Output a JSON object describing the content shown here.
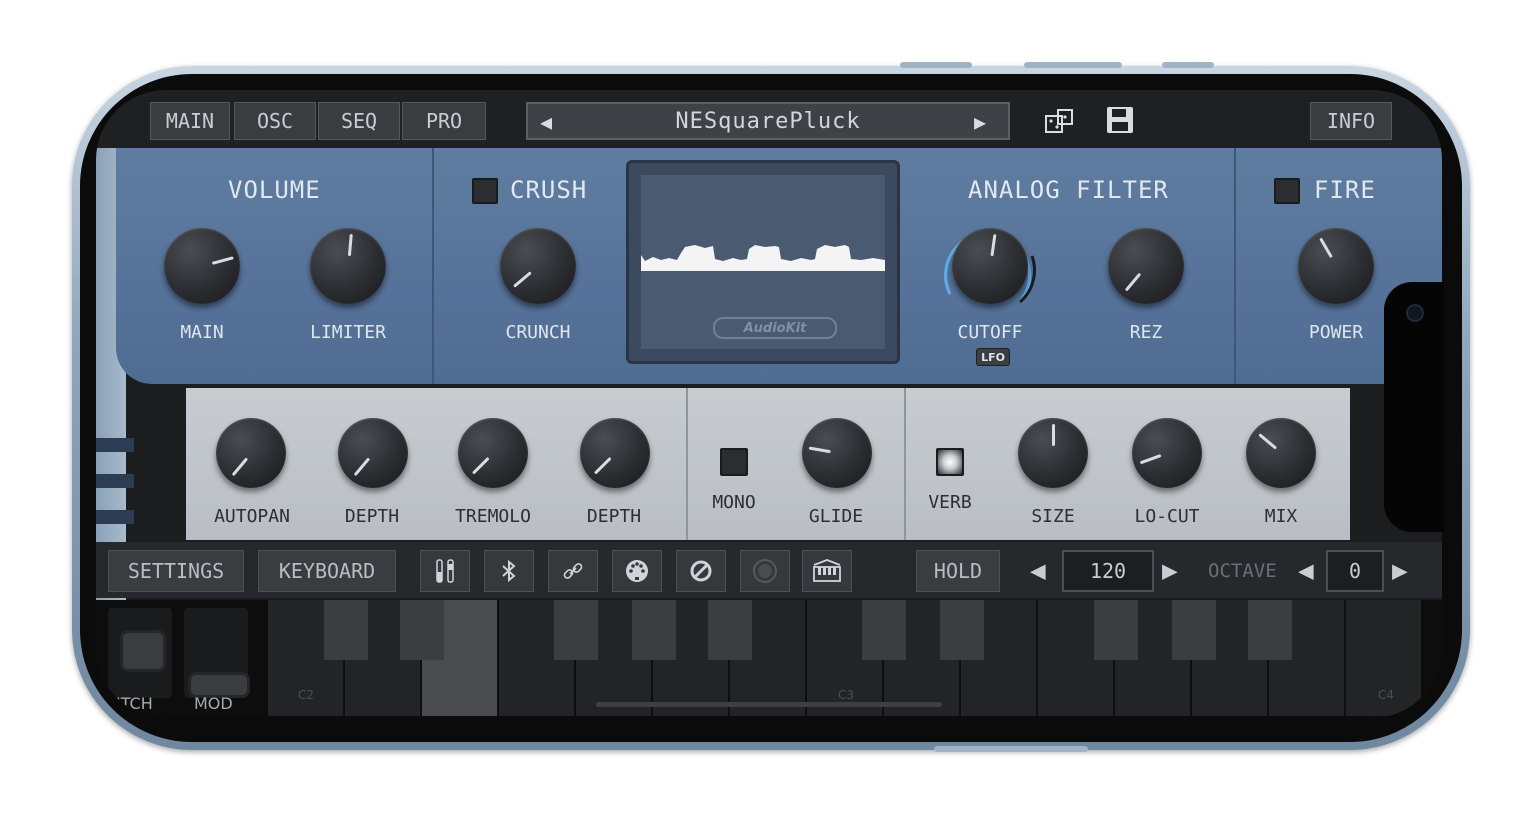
{
  "top": {
    "tabs": [
      "MAIN",
      "OSC",
      "SEQ",
      "PRO"
    ],
    "preset_name": "NESquarePluck",
    "prev_arrow": "◀",
    "next_arrow": "▶",
    "info_label": "INFO",
    "icons": [
      "dice-icon",
      "save-icon"
    ]
  },
  "volume": {
    "title": "VOLUME",
    "knobs": [
      "MAIN",
      "LIMITER"
    ]
  },
  "crush": {
    "title": "CRUSH",
    "knob": "CRUNCH"
  },
  "display": {
    "logo": "AudioKit"
  },
  "filter": {
    "title": "ANALOG FILTER",
    "knobs": [
      "CUTOFF",
      "REZ"
    ],
    "lfo_badge": "LFO"
  },
  "fire": {
    "title": "FIRE",
    "knob": "POWER"
  },
  "fx": {
    "knobs": [
      "AUTOPAN",
      "DEPTH",
      "TREMOLO",
      "DEPTH"
    ],
    "mono_label": "MONO",
    "glide_label": "GLIDE",
    "verb_label": "VERB",
    "verb_knobs": [
      "SIZE",
      "LO-CUT",
      "MIX"
    ]
  },
  "bottom": {
    "settings_label": "SETTINGS",
    "keyboard_label": "KEYBOARD",
    "icon_buttons": [
      "sliders-icon",
      "bluetooth-icon",
      "link-icon",
      "midi-icon",
      "disable-icon",
      "record-icon",
      "piano-icon"
    ],
    "hold_label": "HOLD",
    "tempo_value": "120",
    "octave_label": "OCTAVE",
    "octave_value": "0"
  },
  "keyboard": {
    "pitch_label": "ITCH",
    "mod_label": "MOD",
    "note_labels": [
      "C2",
      "C3",
      "C4"
    ]
  },
  "colors": {
    "panel_blue": "#56729a",
    "panel_grey": "#bfc4c9",
    "accent_cyan": "#5fb6ef"
  }
}
